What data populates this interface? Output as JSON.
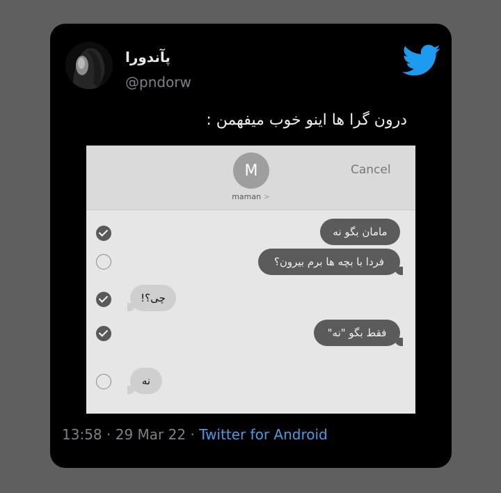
{
  "tweet": {
    "display_name": "پآندورا",
    "handle": "@pndorw",
    "text": "درون گرا ها اینو خوب میفهمن :",
    "time": "13:58",
    "separator": "·",
    "date": "29 Mar 22",
    "source": "Twitter for Android",
    "brand_color": "#1d9bf0",
    "bird_icon": "twitter-bird-icon"
  },
  "screenshot": {
    "contact_initial": "M",
    "contact_name": "maman",
    "contact_chevron": ">",
    "cancel_label": "Cancel",
    "messages": [
      {
        "text": "مامان بگو نه",
        "side": "sent",
        "selected": true
      },
      {
        "text": "فردا با بچه ها برم بیرون؟",
        "side": "sent",
        "selected": false
      },
      {
        "text": "چی؟!",
        "side": "received",
        "selected": true
      },
      {
        "text": "فقط بگو \"نه\"",
        "side": "sent",
        "selected": true
      },
      {
        "text": "نه",
        "side": "received",
        "selected": false
      }
    ]
  }
}
